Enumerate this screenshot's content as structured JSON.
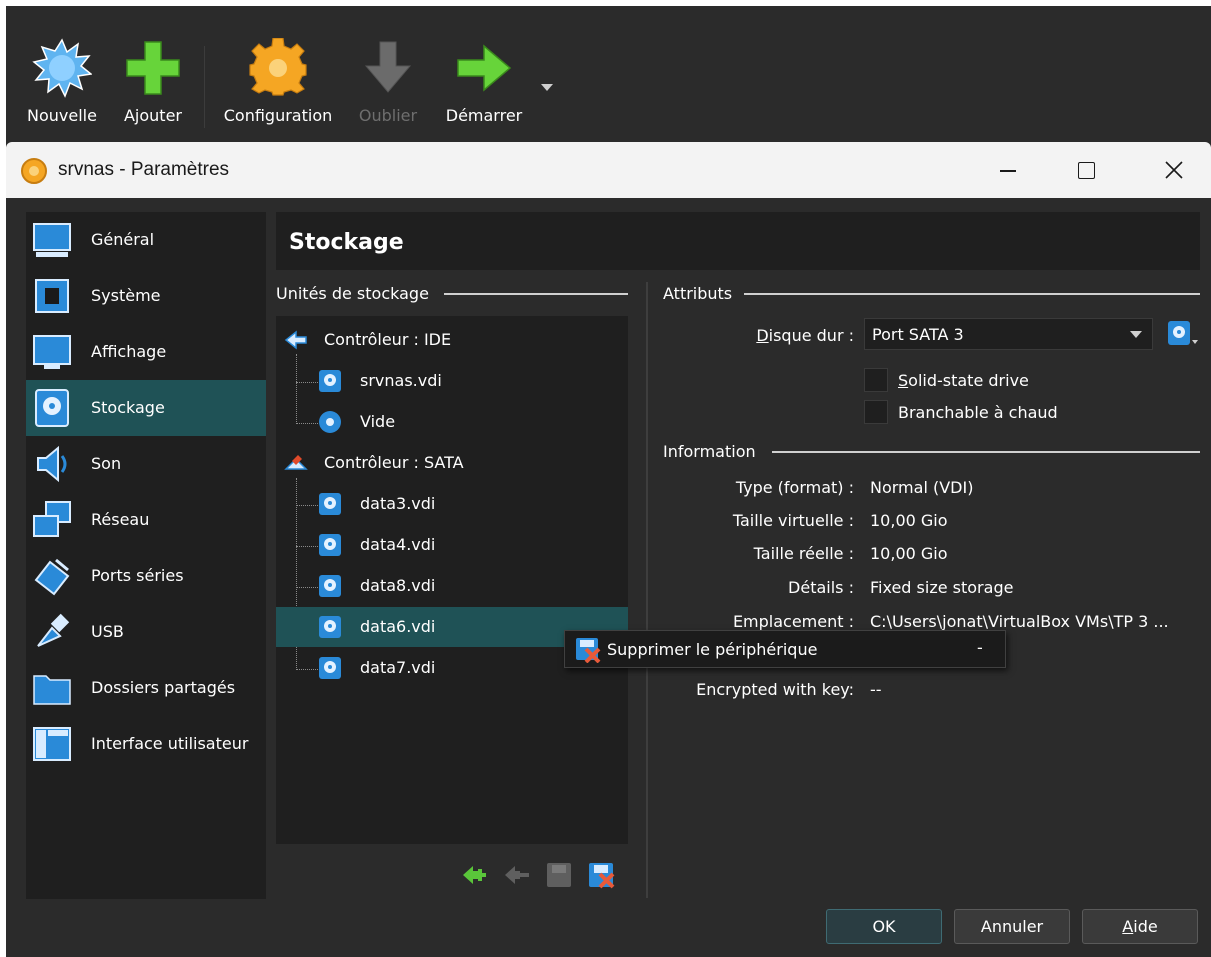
{
  "toolbar": {
    "buttons": [
      {
        "label": "Nouvelle",
        "icon": "new-starburst-icon",
        "enabled": true
      },
      {
        "label": "Ajouter",
        "icon": "add-plus-icon",
        "enabled": true
      },
      {
        "label": "Configuration",
        "icon": "settings-gear-icon",
        "enabled": true
      },
      {
        "label": "Oublier",
        "icon": "discard-arrow-down-icon",
        "enabled": false
      },
      {
        "label": "Démarrer",
        "icon": "start-arrow-right-icon",
        "enabled": true
      }
    ]
  },
  "dialog": {
    "title": "srvnas - Paramètres",
    "page_title": "Stockage",
    "sidebar": {
      "items": [
        {
          "label": "Général",
          "icon": "general-monitor-icon",
          "selected": false
        },
        {
          "label": "Système",
          "icon": "system-chip-icon",
          "selected": false
        },
        {
          "label": "Affichage",
          "icon": "display-monitor-icon",
          "selected": false
        },
        {
          "label": "Stockage",
          "icon": "storage-disk-icon",
          "selected": true
        },
        {
          "label": "Son",
          "icon": "audio-speaker-icon",
          "selected": false
        },
        {
          "label": "Réseau",
          "icon": "network-icon",
          "selected": false
        },
        {
          "label": "Ports séries",
          "icon": "serial-port-icon",
          "selected": false
        },
        {
          "label": "USB",
          "icon": "usb-icon",
          "selected": false
        },
        {
          "label": "Dossiers partagés",
          "icon": "shared-folder-icon",
          "selected": false
        },
        {
          "label": "Interface utilisateur",
          "icon": "user-interface-icon",
          "selected": false
        }
      ]
    },
    "storage": {
      "group_title": "Unités de stockage",
      "tree": [
        {
          "type": "controller",
          "label": "Contrôleur : IDE",
          "icon": "ide-controller-icon"
        },
        {
          "type": "disk",
          "label": "srvnas.vdi",
          "icon": "hard-disk-icon"
        },
        {
          "type": "optical",
          "label": "Vide",
          "icon": "optical-disc-icon"
        },
        {
          "type": "controller",
          "label": "Contrôleur : SATA",
          "icon": "sata-controller-icon"
        },
        {
          "type": "disk",
          "label": "data3.vdi",
          "icon": "hard-disk-icon"
        },
        {
          "type": "disk",
          "label": "data4.vdi",
          "icon": "hard-disk-icon"
        },
        {
          "type": "disk",
          "label": "data8.vdi",
          "icon": "hard-disk-icon"
        },
        {
          "type": "disk",
          "label": "data6.vdi",
          "icon": "hard-disk-icon",
          "selected": true
        },
        {
          "type": "disk",
          "label": "data7.vdi",
          "icon": "hard-disk-icon"
        }
      ],
      "bottom_actions": [
        {
          "name": "add-controller-icon",
          "enabled": true
        },
        {
          "name": "remove-controller-icon",
          "enabled": false
        },
        {
          "name": "add-attachment-icon",
          "enabled": false
        },
        {
          "name": "remove-attachment-icon",
          "enabled": true
        }
      ]
    },
    "attributes": {
      "group_title": "Attributs",
      "disk_label": "Disque dur :",
      "disk_value": "Port SATA 3",
      "ssd_label": "Solid-state drive",
      "hotplug_label": "Branchable à chaud"
    },
    "information": {
      "group_title": "Information",
      "rows": [
        {
          "label": "Type (format) :",
          "value": "Normal (VDI)"
        },
        {
          "label": "Taille virtuelle :",
          "value": "10,00 Gio"
        },
        {
          "label": "Taille réelle :",
          "value": "10,00 Gio"
        },
        {
          "label": "Détails :",
          "value": "Fixed size storage"
        },
        {
          "label": "Emplacement :",
          "value": "C:\\Users\\jonat\\VirtualBox VMs\\TP 3 ..."
        }
      ],
      "encrypted_label": "Encrypted with key:",
      "encrypted_value": "--"
    },
    "context_tooltip": {
      "label": "Supprimer le périphérique",
      "shortcut": "-"
    },
    "buttons": {
      "ok": "OK",
      "cancel": "Annuler",
      "help": "Aide"
    }
  },
  "colors": {
    "background": "#2b2b2b",
    "panel": "#1f1f1f",
    "selection": "#1f5256",
    "titlebar": "#f3f3f3"
  }
}
